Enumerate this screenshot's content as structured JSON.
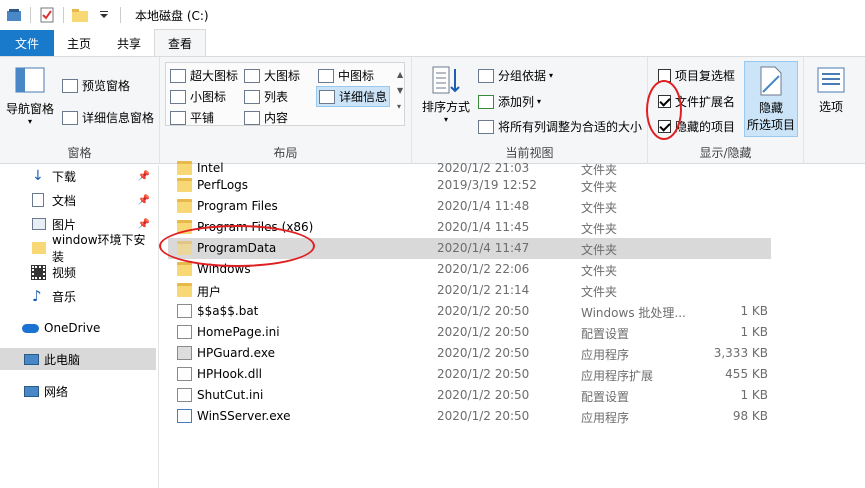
{
  "window": {
    "title": "本地磁盘 (C:)"
  },
  "tabs": {
    "file": "文件",
    "home": "主页",
    "share": "共享",
    "view": "查看"
  },
  "ribbon": {
    "panes": {
      "label": "窗格",
      "nav_pane": "导航窗格",
      "preview_pane": "预览窗格",
      "details_pane": "详细信息窗格"
    },
    "layout": {
      "label": "布局",
      "extra_large": "超大图标",
      "large": "大图标",
      "medium": "中图标",
      "small": "小图标",
      "list": "列表",
      "details": "详细信息",
      "tiles": "平铺",
      "content": "内容"
    },
    "current_view": {
      "label": "当前视图",
      "sort_by": "排序方式",
      "group_by": "分组依据",
      "add_columns": "添加列",
      "size_all_columns": "将所有列调整为合适的大小"
    },
    "show_hide": {
      "label": "显示/隐藏",
      "item_checkboxes": "项目复选框",
      "item_checkboxes_checked": false,
      "file_name_extensions": "文件扩展名",
      "file_name_extensions_checked": true,
      "hidden_items": "隐藏的项目",
      "hidden_items_checked": true,
      "hide_selected_line1": "隐藏",
      "hide_selected_line2": "所选项目"
    },
    "options": "选项"
  },
  "nav": {
    "items": [
      {
        "label": "下载",
        "icon": "download-icon",
        "pinned": true
      },
      {
        "label": "文档",
        "icon": "document-icon",
        "pinned": true
      },
      {
        "label": "图片",
        "icon": "picture-icon",
        "pinned": true
      },
      {
        "label": "window环境下安装",
        "icon": "folder-icon",
        "pinned": false
      },
      {
        "label": "视频",
        "icon": "video-icon",
        "pinned": false
      },
      {
        "label": "音乐",
        "icon": "music-icon",
        "pinned": false
      },
      {
        "label": "OneDrive",
        "icon": "cloud-icon",
        "pinned": false
      },
      {
        "label": "此电脑",
        "icon": "computer-icon",
        "pinned": false
      },
      {
        "label": "网络",
        "icon": "network-icon",
        "pinned": false
      }
    ]
  },
  "files": [
    {
      "name": "Intel",
      "date": "2020/1/2 21:03",
      "type": "文件夹",
      "size": "",
      "kind": "folder"
    },
    {
      "name": "PerfLogs",
      "date": "2019/3/19 12:52",
      "type": "文件夹",
      "size": "",
      "kind": "folder"
    },
    {
      "name": "Program Files",
      "date": "2020/1/4 11:48",
      "type": "文件夹",
      "size": "",
      "kind": "folder"
    },
    {
      "name": "Program Files (x86)",
      "date": "2020/1/4 11:45",
      "type": "文件夹",
      "size": "",
      "kind": "folder"
    },
    {
      "name": "ProgramData",
      "date": "2020/1/4 11:47",
      "type": "文件夹",
      "size": "",
      "kind": "folder",
      "selected": true
    },
    {
      "name": "Windows",
      "date": "2020/1/2 22:06",
      "type": "文件夹",
      "size": "",
      "kind": "folder"
    },
    {
      "name": "用户",
      "date": "2020/1/2 21:14",
      "type": "文件夹",
      "size": "",
      "kind": "folder"
    },
    {
      "name": "$$a$$.bat",
      "date": "2020/1/2 20:50",
      "type": "Windows 批处理...",
      "size": "1 KB",
      "kind": "file"
    },
    {
      "name": "HomePage.ini",
      "date": "2020/1/2 20:50",
      "type": "配置设置",
      "size": "1 KB",
      "kind": "file"
    },
    {
      "name": "HPGuard.exe",
      "date": "2020/1/2 20:50",
      "type": "应用程序",
      "size": "3,333 KB",
      "kind": "file"
    },
    {
      "name": "HPHook.dll",
      "date": "2020/1/2 20:50",
      "type": "应用程序扩展",
      "size": "455 KB",
      "kind": "file"
    },
    {
      "name": "ShutCut.ini",
      "date": "2020/1/2 20:50",
      "type": "配置设置",
      "size": "1 KB",
      "kind": "file"
    },
    {
      "name": "WinSServer.exe",
      "date": "2020/1/2 20:50",
      "type": "应用程序",
      "size": "98 KB",
      "kind": "file"
    }
  ],
  "colors": {
    "file_tab": "#1979ca",
    "annotation_circle": "#e02020",
    "selection": "#d9d9d9"
  }
}
